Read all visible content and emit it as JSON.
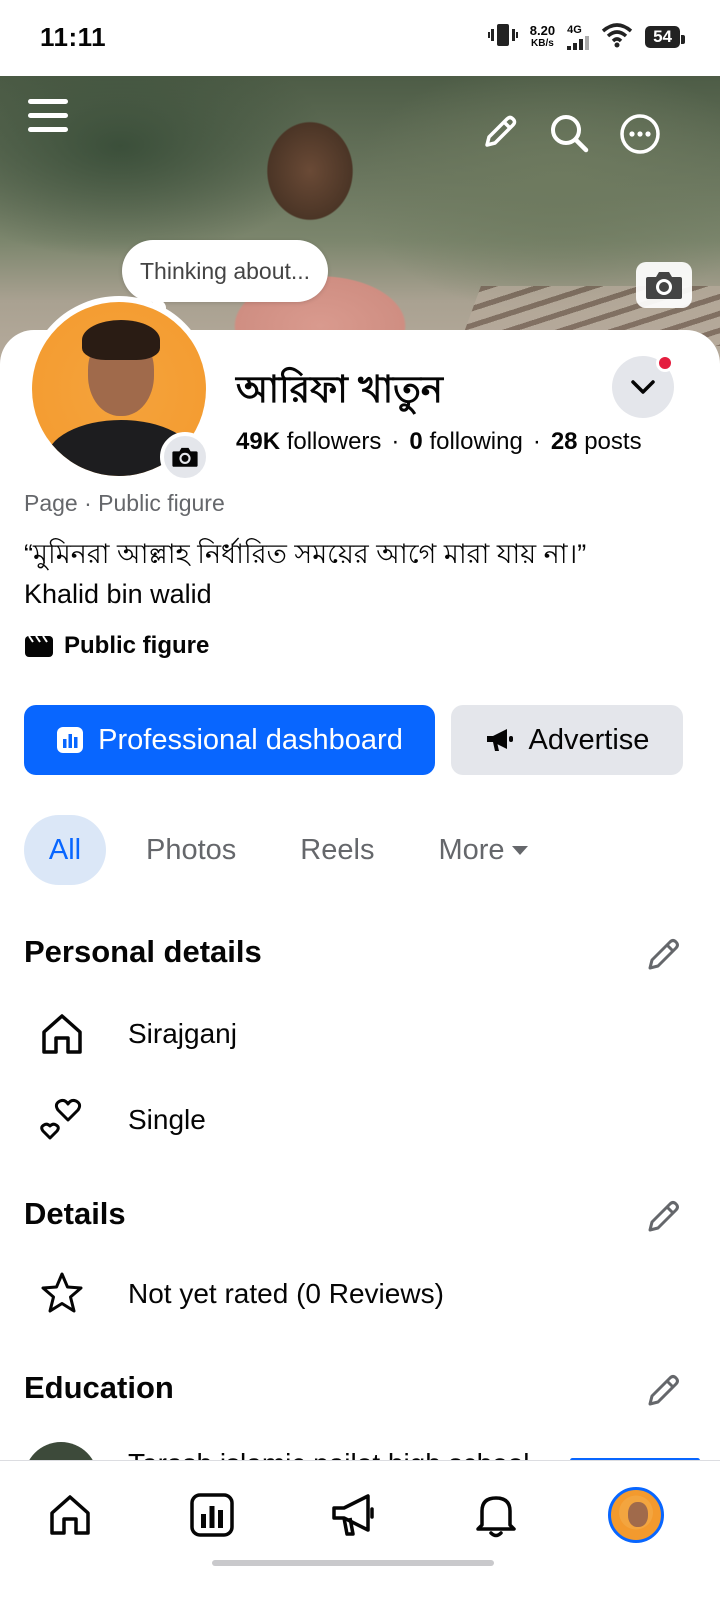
{
  "status_bar": {
    "time": "11:11",
    "speed_value": "8.20",
    "speed_unit": "KB/s",
    "network": "4G",
    "battery": "54"
  },
  "cover": {
    "thinking_prompt": "Thinking about..."
  },
  "profile": {
    "name": "আরিফা খাতুন",
    "followers_count": "49K",
    "followers_label": "followers",
    "following_count": "0",
    "following_label": "following",
    "posts_count": "28",
    "posts_label": "posts",
    "page_type": "Page",
    "page_category": "Public figure",
    "bio_line1": "“মুমিনরা আল্লাহ নির্ধারিত সময়ের আগে মারা যায় না।”",
    "bio_line2": "Khalid bin walid",
    "category_label": "Public figure"
  },
  "actions": {
    "professional_dashboard": "Professional dashboard",
    "advertise": "Advertise"
  },
  "tabs": {
    "all": "All",
    "photos": "Photos",
    "reels": "Reels",
    "more": "More"
  },
  "personal_details": {
    "title": "Personal details",
    "location": "Sirajganj",
    "relationship": "Single"
  },
  "details": {
    "title": "Details",
    "rating": "Not yet rated (0 Reviews)"
  },
  "education": {
    "title": "Education",
    "school_partial": "Tarash islamic pailot high school"
  },
  "colors": {
    "accent": "#0866ff",
    "notification": "#e41e3f",
    "secondary_text": "#65676b",
    "button_gray": "#e4e6eb"
  },
  "nav": [
    "home-icon",
    "dashboard-icon",
    "megaphone-icon",
    "bell-icon",
    "profile-avatar"
  ]
}
